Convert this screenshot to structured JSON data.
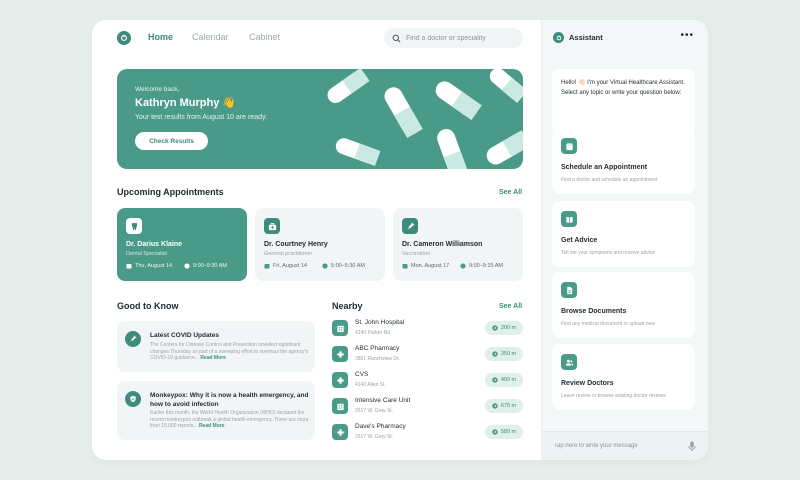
{
  "nav": {
    "links": [
      "Home",
      "Calendar",
      "Cabinet"
    ],
    "search_placeholder": "Find a doctor or speciality"
  },
  "hero": {
    "welcome": "Welcome back,",
    "name": "Kathryn Murphy 👋",
    "message": "Your test results from August 10 are ready.",
    "button": "Check Results"
  },
  "appointments": {
    "title": "Upcoming Appointments",
    "see_all": "See All",
    "items": [
      {
        "name": "Dr. Darius Klaine",
        "specialty": "Dental Specialist",
        "date": "Thu, August 14",
        "time": "9:00–9:30 AM",
        "icon": "tooth-icon"
      },
      {
        "name": "Dr. Courtney Henry",
        "specialty": "General practitioner",
        "date": "Fri, August 14",
        "time": "5:00–5:30 AM",
        "icon": "medkit-icon"
      },
      {
        "name": "Dr. Cameron Williamson",
        "specialty": "Vaccination",
        "date": "Mon, August 17",
        "time": "9:00–9:15 AM",
        "icon": "syringe-icon"
      }
    ]
  },
  "good_to_know": {
    "title": "Good to Know",
    "items": [
      {
        "title": "Latest COVID Updates",
        "body": "The Centers for Disease Control and Prevention unveiled significant changes Thursday as part of a sweeping effort to overhaul the agency's COVID-19 guidance...",
        "read_more": "Read More",
        "icon": "syringe-icon"
      },
      {
        "title": "Monkeypox: Why it is now a health emergency, and how to avoid infection",
        "body": "Earlier this month, the World Health Organization (WHO) declared the recent monkeypox outbreak a global health emergency. There are more than 15,000 reports...",
        "read_more": "Read More",
        "icon": "shield-icon"
      }
    ]
  },
  "nearby": {
    "title": "Nearby",
    "see_all": "See All",
    "items": [
      {
        "name": "St. John Hospital",
        "address": "4140 Parker Rd.",
        "distance": "200 m",
        "icon": "hospital-icon"
      },
      {
        "name": "ABC Pharmacy",
        "address": "3891 Ranchview Dr.",
        "distance": "350 m",
        "icon": "pharmacy-cross-icon"
      },
      {
        "name": "CVS",
        "address": "4140 Allen St.",
        "distance": "400 m",
        "icon": "pharmacy-cross-icon"
      },
      {
        "name": "Intensive Care Unit",
        "address": "2517 W. Gray St.",
        "distance": "675 m",
        "icon": "hospital-icon"
      },
      {
        "name": "Dave's Pharmacy",
        "address": "2517 W. Gray St.",
        "distance": "580 m",
        "icon": "pharmacy-cross-icon"
      }
    ]
  },
  "assistant": {
    "title": "Assistant",
    "more": "•••",
    "greeting": "Hello! 👋🏻 I'm your Virtual Healthcare Assistant. Select any topic or write your question below:",
    "options": [
      {
        "title": "Schedule an Appointment",
        "desc": "Find a doctor and schedule an appointment",
        "icon": "calendar-icon"
      },
      {
        "title": "Get Advice",
        "desc": "Tell me your symptoms and receive advice",
        "icon": "book-icon"
      },
      {
        "title": "Browse Documents",
        "desc": "Find any medical document or upload new",
        "icon": "document-icon"
      },
      {
        "title": "Review Doctors",
        "desc": "Leave review or browse existing doctor reviews",
        "icon": "users-icon"
      }
    ],
    "message_placeholder": "Tap here to write your message"
  },
  "colors": {
    "accent": "#3c8c7c",
    "card_green": "#4a9a89",
    "background": "#e6eeec"
  }
}
